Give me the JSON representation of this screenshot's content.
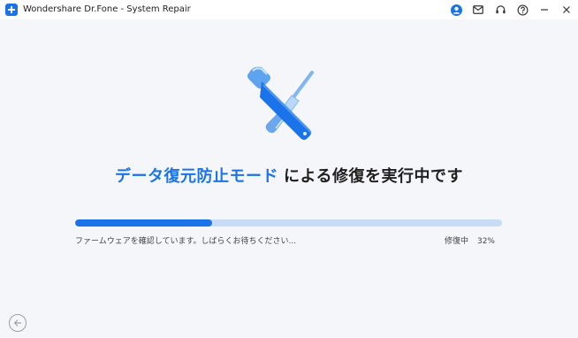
{
  "window": {
    "title": "Wondershare Dr.Fone - System Repair",
    "icons": [
      "account-icon",
      "mail-icon",
      "support-icon",
      "help-icon",
      "minimize-icon",
      "close-icon"
    ]
  },
  "main": {
    "headline_accent": "データ復元防止モード",
    "headline_rest": "による修復を実行中です",
    "status_left": "ファームウェアを確認しています。しばらくお待ちください...",
    "status_right_label": "修復中",
    "status_right_value": "32%",
    "progress_fraction": 0.32
  },
  "colors": {
    "accent": "#1a73e8",
    "track": "#c9dcf6",
    "background": "#f4f6fa"
  }
}
